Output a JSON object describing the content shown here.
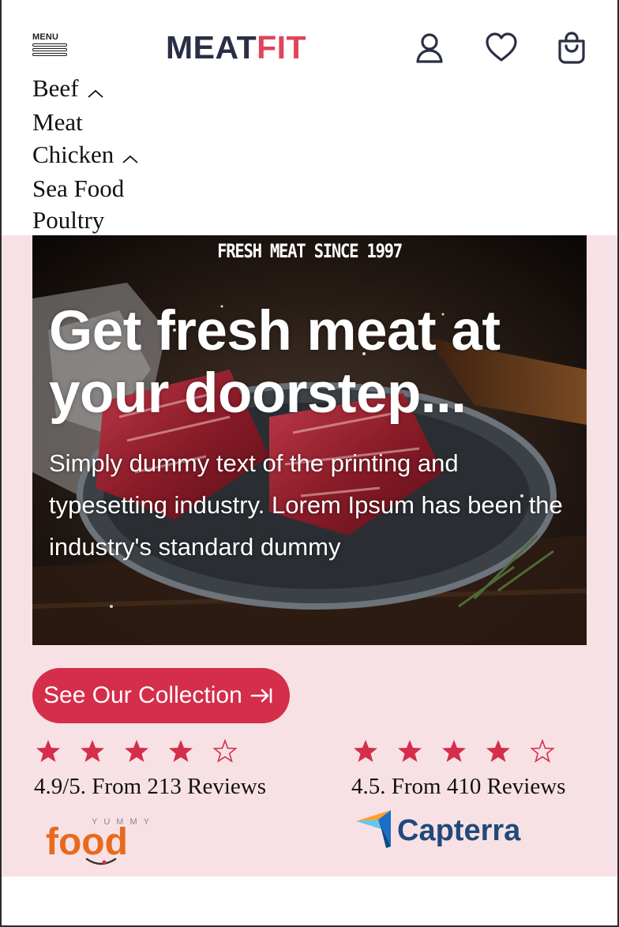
{
  "header": {
    "menu_label": "MENU",
    "logo_part1": "MEAT",
    "logo_part2": "FIT",
    "icons": [
      "user-icon",
      "heart-icon",
      "shopping-bag-icon"
    ]
  },
  "nav": [
    {
      "label": "Beef",
      "expandable": true
    },
    {
      "label": "Meat",
      "expandable": false
    },
    {
      "label": "Chicken",
      "expandable": true
    },
    {
      "label": "Sea Food",
      "expandable": false
    },
    {
      "label": "Poultry",
      "expandable": false
    }
  ],
  "hero": {
    "tagline": "FRESH MEAT SINCE 1997",
    "title": "Get fresh meat at your doorstep...",
    "body": "Simply dummy text of the printing and typesetting industry. Lorem Ipsum has been the industry's standard dummy",
    "cta_label": "See Our Collection"
  },
  "reviews": [
    {
      "rating_stars": 4,
      "max_stars": 5,
      "text": "4.9/5. From 213 Reviews",
      "brand": "YUMMY food",
      "brand_logo": {
        "small": "YUMMY",
        "big": "food"
      }
    },
    {
      "rating_stars": 4,
      "max_stars": 5,
      "text": "4.5. From 410 Reviews",
      "brand": "Capterra",
      "brand_logo": {
        "big": "Capterra"
      }
    }
  ],
  "colors": {
    "accent": "#d42e4a",
    "logo_dark": "#2a2f45",
    "logo_red": "#e0455b",
    "section_bg": "#f8e1e4"
  }
}
